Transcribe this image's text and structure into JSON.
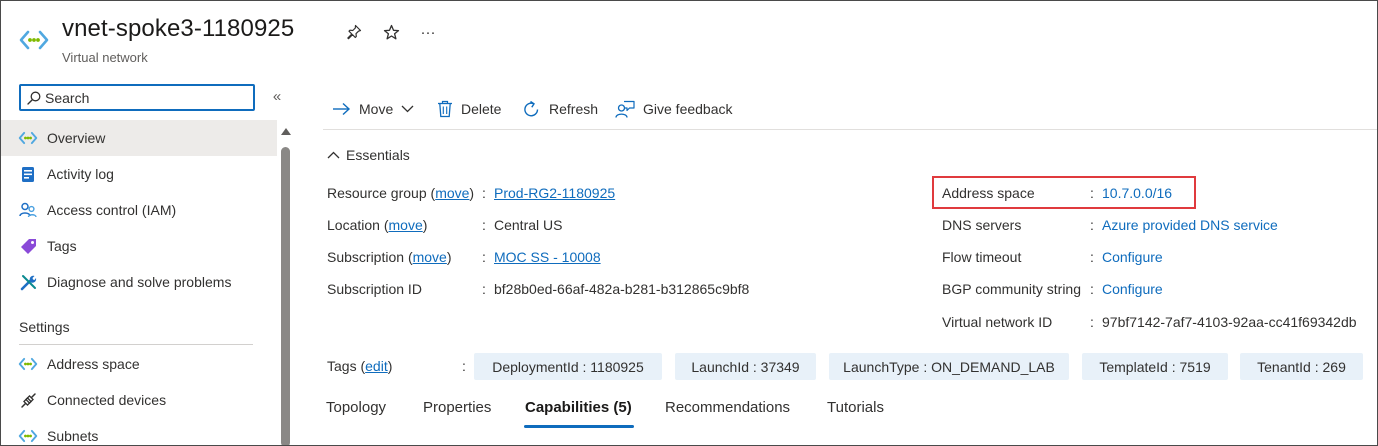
{
  "header": {
    "title": "vnet-spoke3-1180925",
    "subtitle": "Virtual network",
    "icon": "vnet-icon",
    "actions": [
      "pin-icon",
      "star-icon",
      "more-icon"
    ],
    "more_glyph": "···"
  },
  "sidebar": {
    "search": {
      "value": "",
      "placeholder": "Search"
    },
    "collapse_glyph": "«",
    "items": [
      {
        "label": "Overview",
        "icon": "vnet-icon",
        "selected": true
      },
      {
        "label": "Activity log",
        "icon": "activity-log-icon"
      },
      {
        "label": "Access control (IAM)",
        "icon": "people-icon"
      },
      {
        "label": "Tags",
        "icon": "tag-icon"
      },
      {
        "label": "Diagnose and solve problems",
        "icon": "wrench-icon"
      }
    ],
    "settings_header": "Settings",
    "settings_items": [
      {
        "label": "Address space",
        "icon": "vnet-icon"
      },
      {
        "label": "Connected devices",
        "icon": "plug-icon"
      },
      {
        "label": "Subnets",
        "icon": "vnet-icon"
      }
    ]
  },
  "toolbar": {
    "move": "Move",
    "delete": "Delete",
    "refresh": "Refresh",
    "feedback": "Give feedback"
  },
  "essentials": {
    "label": "Essentials",
    "left": {
      "resource_group": {
        "label": "Resource group",
        "action": "move",
        "value": "Prod-RG2-1180925"
      },
      "location": {
        "label": "Location",
        "action": "move",
        "value": "Central US"
      },
      "subscription": {
        "label": "Subscription",
        "action": "move",
        "value": "MOC SS - 10008"
      },
      "subscription_id": {
        "label": "Subscription ID",
        "value": "bf28b0ed-66af-482a-b281-b312865c9bf8"
      }
    },
    "right": {
      "address_space": {
        "label": "Address space",
        "value": "10.7.0.0/16"
      },
      "dns_servers": {
        "label": "DNS servers",
        "value": "Azure provided DNS service"
      },
      "flow_timeout": {
        "label": "Flow timeout",
        "value": "Configure"
      },
      "bgp": {
        "label": "BGP community string",
        "value": "Configure"
      },
      "vnet_id": {
        "label": "Virtual network ID",
        "value": "97bf7142-7af7-4103-92aa-cc41f69342db"
      }
    },
    "colon": ":",
    "paren_open": "(",
    "paren_close": ")"
  },
  "tags": {
    "label": "Tags",
    "action": "edit",
    "items": [
      "DeploymentId : 1180925",
      "LaunchId : 37349",
      "LaunchType : ON_DEMAND_LAB",
      "TemplateId : 7519",
      "TenantId : 269"
    ]
  },
  "tabs": [
    "Topology",
    "Properties",
    "Capabilities (5)",
    "Recommendations",
    "Tutorials"
  ],
  "active_tab": "Capabilities (5)",
  "colors": {
    "accent": "#0f6cbd",
    "highlight": "#e03a3e",
    "tag_bg": "#e8f1f9"
  }
}
